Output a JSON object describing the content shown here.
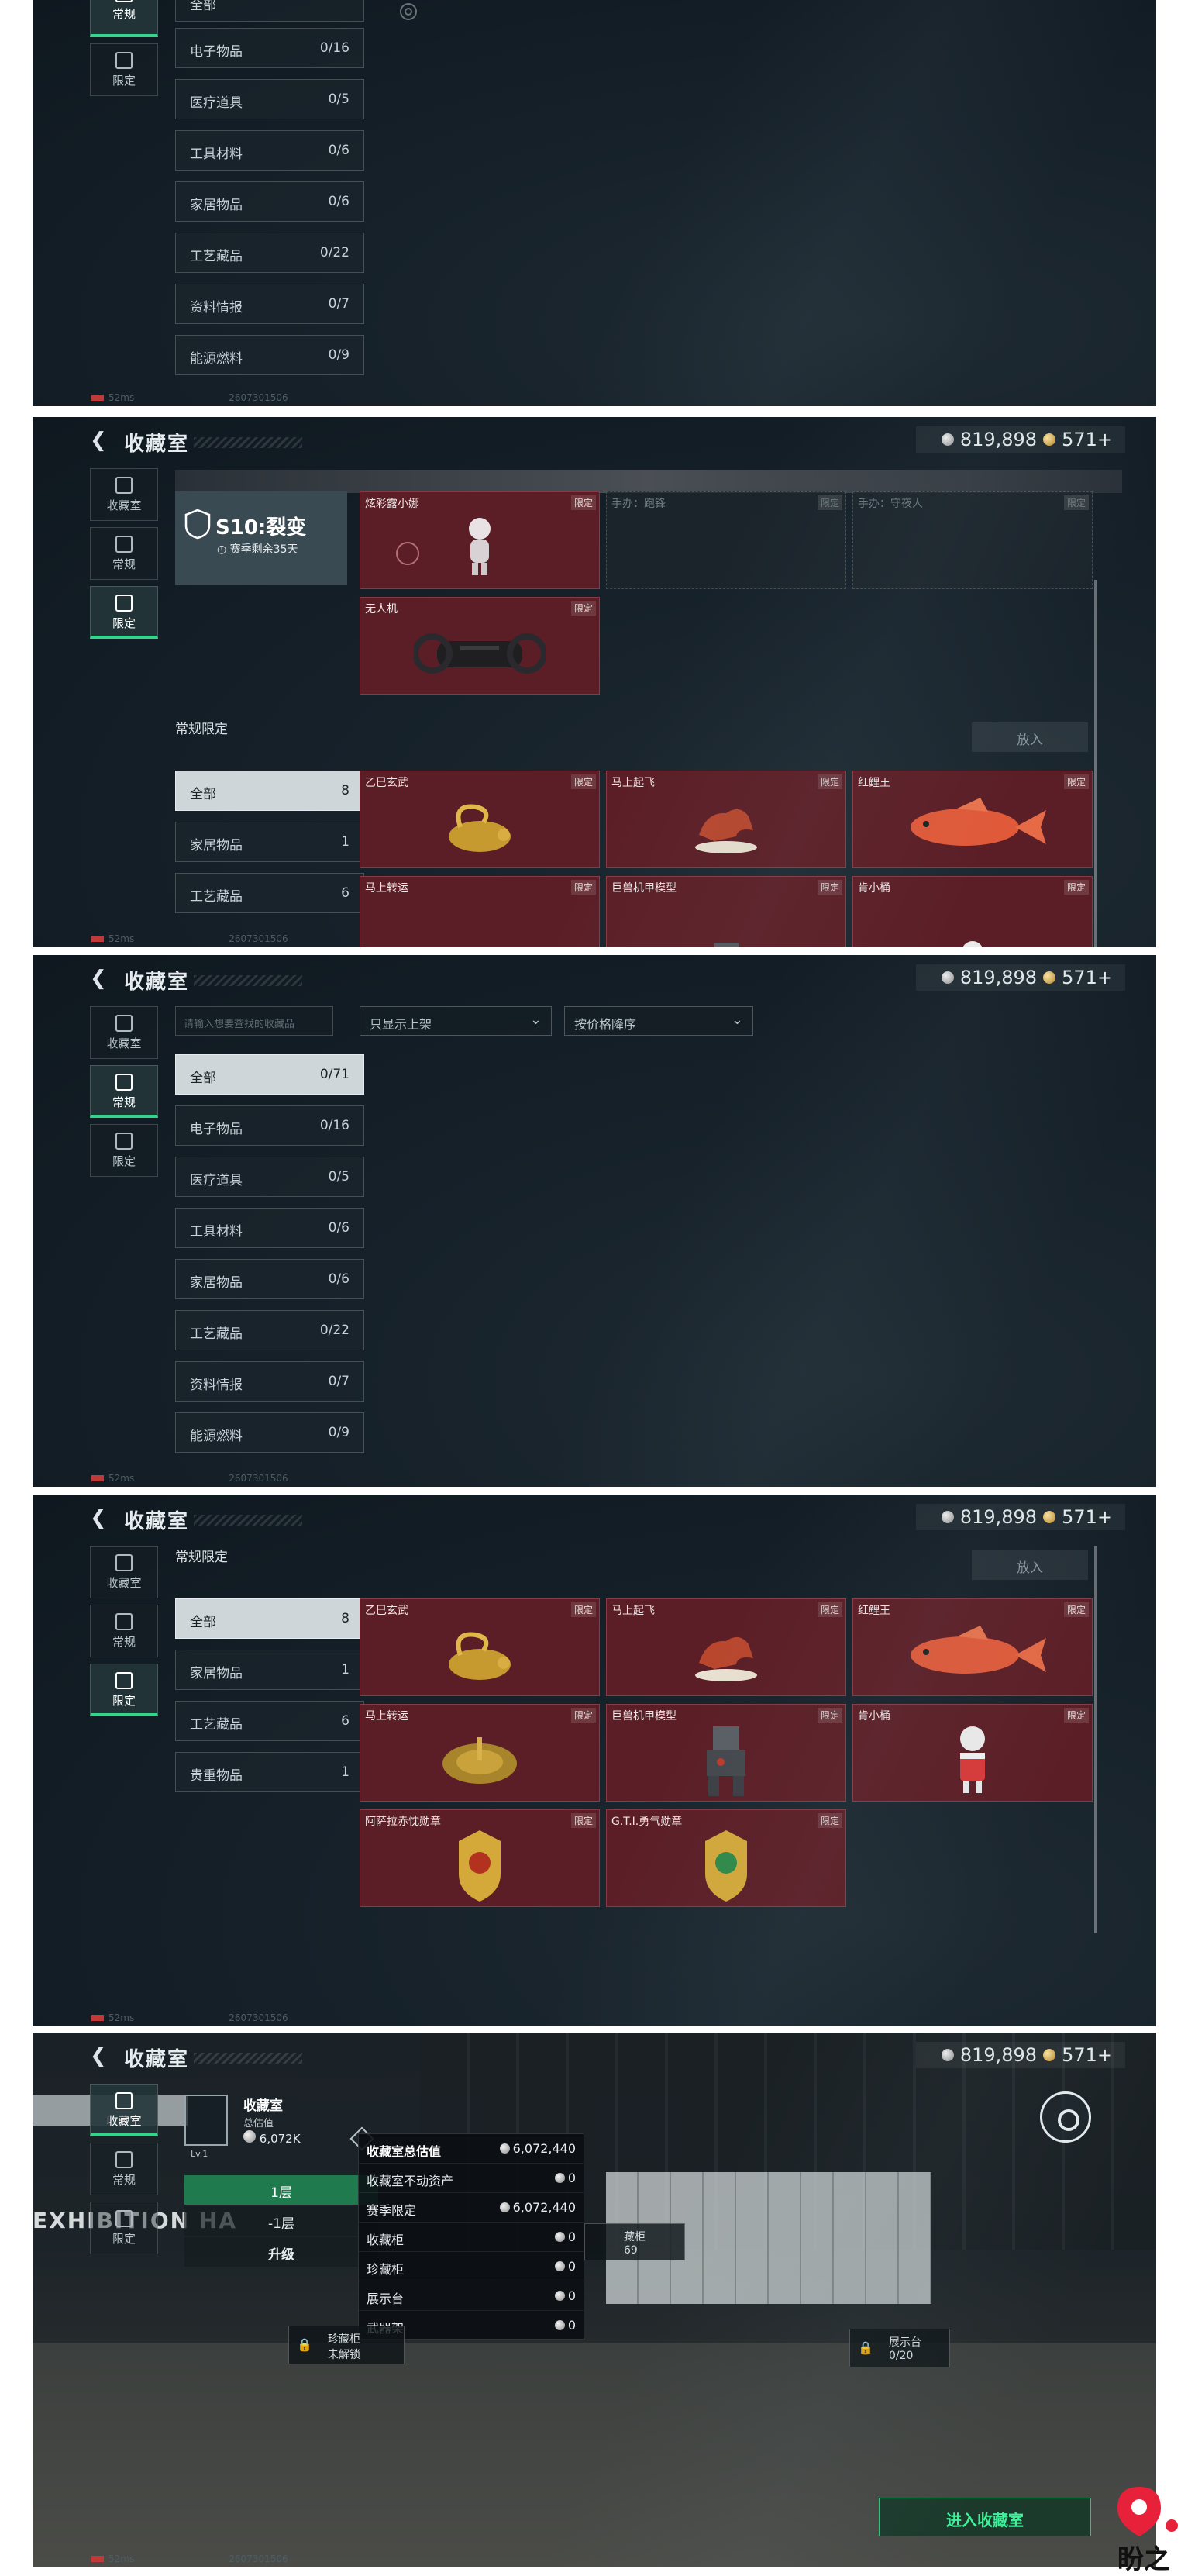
{
  "common": {
    "title": "收藏室",
    "currency_silver": "819,898",
    "currency_gold": "571+",
    "status_ping": "52ms",
    "status_id": "2607301506",
    "colors": {
      "accent_green": "#34d58a",
      "card_red": "#5c1e26",
      "panel_dark": "#16212a"
    }
  },
  "tabs": {
    "collection": "收藏室",
    "regular": "常规",
    "limited": "限定"
  },
  "panel1": {
    "categories": [
      {
        "label": "电子物品",
        "count": "0/16"
      },
      {
        "label": "医疗道具",
        "count": "0/5"
      },
      {
        "label": "工具材料",
        "count": "0/6"
      },
      {
        "label": "家居物品",
        "count": "0/6"
      },
      {
        "label": "工艺藏品",
        "count": "0/22"
      },
      {
        "label": "资料情报",
        "count": "0/7"
      },
      {
        "label": "能源燃料",
        "count": "0/9"
      }
    ]
  },
  "panel2": {
    "season_title": "S10:裂变",
    "season_sub": "赛季剩余35天",
    "season_cards": [
      {
        "name": "炫彩露小娜",
        "tag": "限定",
        "icon": "doll-figure-icon"
      },
      {
        "name": "手办：跑锋",
        "tag": "限定",
        "icon": ""
      },
      {
        "name": "手办：守夜人",
        "tag": "限定",
        "icon": ""
      },
      {
        "name": "无人机",
        "tag": "限定",
        "icon": "drone-icon"
      }
    ],
    "section_label": "常规限定",
    "place_button": "放入",
    "categories": [
      {
        "label": "全部",
        "count": "8"
      },
      {
        "label": "家居物品",
        "count": "1"
      },
      {
        "label": "工艺藏品",
        "count": "6"
      }
    ],
    "cards": [
      {
        "name": "乙巳玄武",
        "tag": "限定",
        "icon": "golden-tortoise-icon"
      },
      {
        "name": "马上起飞",
        "tag": "限定",
        "icon": "horse-statue-icon"
      },
      {
        "name": "红鲤王",
        "tag": "限定",
        "icon": "red-carp-icon"
      },
      {
        "name": "马上转运",
        "tag": "限定",
        "icon": ""
      },
      {
        "name": "巨兽机甲模型",
        "tag": "限定",
        "icon": ""
      },
      {
        "name": "肯小桶",
        "tag": "限定",
        "icon": ""
      }
    ]
  },
  "panel3": {
    "search_placeholder": "请输入想要查找的收藏品",
    "filter_shelf": "只显示上架",
    "sort_option": "按价格降序",
    "categories": [
      {
        "label": "全部",
        "count": "0/71"
      },
      {
        "label": "电子物品",
        "count": "0/16"
      },
      {
        "label": "医疗道具",
        "count": "0/5"
      },
      {
        "label": "工具材料",
        "count": "0/6"
      },
      {
        "label": "家居物品",
        "count": "0/6"
      },
      {
        "label": "工艺藏品",
        "count": "0/22"
      },
      {
        "label": "资料情报",
        "count": "0/7"
      },
      {
        "label": "能源燃料",
        "count": "0/9"
      }
    ]
  },
  "panel4": {
    "section_label": "常规限定",
    "place_button": "放入",
    "categories": [
      {
        "label": "全部",
        "count": "8"
      },
      {
        "label": "家居物品",
        "count": "1"
      },
      {
        "label": "工艺藏品",
        "count": "6"
      },
      {
        "label": "贵重物品",
        "count": "1"
      }
    ],
    "cards": [
      {
        "name": "乙巳玄武",
        "tag": "限定",
        "icon": "golden-tortoise-icon"
      },
      {
        "name": "马上起飞",
        "tag": "限定",
        "icon": "horse-statue-icon"
      },
      {
        "name": "红鲤王",
        "tag": "限定",
        "icon": "red-carp-icon"
      },
      {
        "name": "马上转运",
        "tag": "限定",
        "icon": "golden-disc-icon"
      },
      {
        "name": "巨兽机甲模型",
        "tag": "限定",
        "icon": "mech-model-icon"
      },
      {
        "name": "肯小桶",
        "tag": "限定",
        "icon": "bucket-mascot-icon"
      },
      {
        "name": "阿萨拉赤忱勋章",
        "tag": "限定",
        "icon": "medal-icon"
      },
      {
        "name": "G.T.I.勇气勋章",
        "tag": "限定",
        "icon": "medal-icon"
      }
    ]
  },
  "panel5": {
    "exhibition_text": "EXHIBITION HA",
    "info_title": "收藏室",
    "info_sub": "总估值",
    "info_value": "6,072K",
    "level": "Lv.1",
    "floor_1": "1层",
    "floor_minus1": "-1层",
    "upgrade": "升级",
    "value_rows": [
      {
        "label": "收藏室总估值",
        "value": "6,072,440"
      },
      {
        "label": "收藏室不动资产",
        "value": "0"
      },
      {
        "label": "赛季限定",
        "value": "6,072,440"
      },
      {
        "label": "收藏柜",
        "value": "0"
      },
      {
        "label": "珍藏柜",
        "value": "0"
      },
      {
        "label": "展示台",
        "value": "0"
      },
      {
        "label": "武器架",
        "value": "0"
      }
    ],
    "rare_cabinet": "珍藏柜",
    "not_unlocked": "未解锁",
    "display_stand": "展示台",
    "display_count": "0/20",
    "cabinet_tag": "藏柜",
    "cabinet_num": "69",
    "enter_button": "进入收藏室"
  },
  "watermark": "盼之"
}
